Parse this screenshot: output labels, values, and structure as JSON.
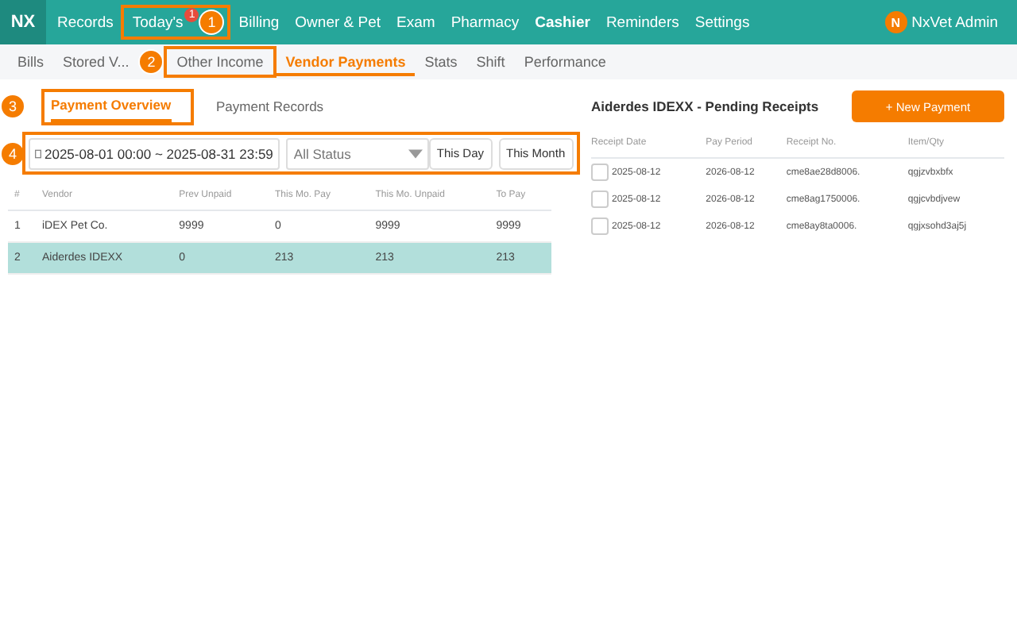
{
  "nav": {
    "logo": "NX",
    "items": [
      {
        "label": "Records",
        "selected": false
      },
      {
        "label": "Today's",
        "selected": false,
        "badge": "1"
      },
      {
        "label": "Billing",
        "selected": false
      },
      {
        "label": "Owner & Pet",
        "selected": false
      },
      {
        "label": "Exam",
        "selected": false
      },
      {
        "label": "Pharmacy",
        "selected": false
      },
      {
        "label": "Cashier",
        "selected": true
      },
      {
        "label": "Reminders",
        "selected": false
      },
      {
        "label": "Settings",
        "selected": false
      }
    ],
    "user": {
      "initial": "N",
      "name": "NxVet Admin"
    }
  },
  "subnav": [
    {
      "label": "Bills",
      "selected": false
    },
    {
      "label": "Stored V...",
      "selected": false
    },
    {
      "label": "Other Income",
      "selected": false
    },
    {
      "label": "Vendor Payments",
      "selected": true
    },
    {
      "label": "Stats",
      "selected": false
    },
    {
      "label": "Shift",
      "selected": false
    },
    {
      "label": "Performance",
      "selected": false
    }
  ],
  "tabs": [
    {
      "label": "Payment Overview",
      "selected": true
    },
    {
      "label": "Payment Records",
      "selected": false
    }
  ],
  "filters": {
    "date_range": "2025-08-01 00:00 ~ 2025-08-31 23:59",
    "status": {
      "placeholder": "All Status"
    },
    "buttons": [
      "This Day",
      "This Month"
    ]
  },
  "vendor_table": {
    "columns": [
      "#",
      "Vendor",
      "Prev Unpaid",
      "This Mo. Pay",
      "This Mo. Unpaid",
      "To Pay"
    ],
    "rows": [
      {
        "cells": [
          "1",
          "iDEX Pet Co.",
          "9999",
          "0",
          "9999",
          "9999"
        ],
        "selected": false
      },
      {
        "cells": [
          "2",
          "Aiderdes IDEXX",
          "0",
          "213",
          "213",
          "213"
        ],
        "selected": true
      }
    ]
  },
  "receipts": {
    "title": "Aiderdes IDEXX - Pending Receipts",
    "new_button": "+ New Payment",
    "columns": [
      "Receipt Date",
      "Pay Period",
      "Receipt No.",
      "Item/Qty"
    ],
    "rows": [
      {
        "checked": false,
        "cells": [
          "2025-08-12",
          "2026-08-12",
          "cme8ae28d8006.",
          "qgjzvbxbfx"
        ]
      },
      {
        "checked": false,
        "cells": [
          "2025-08-12",
          "2026-08-12",
          "cme8ag1750006.",
          "qgjcvbdjvew"
        ]
      },
      {
        "checked": false,
        "cells": [
          "2025-08-12",
          "2026-08-12",
          "cme8ay8ta0006.",
          "qgjxsohd3aj5j"
        ]
      }
    ]
  },
  "annotations": [
    {
      "number": "1"
    },
    {
      "number": "2"
    },
    {
      "number": "3"
    },
    {
      "number": "4"
    }
  ]
}
